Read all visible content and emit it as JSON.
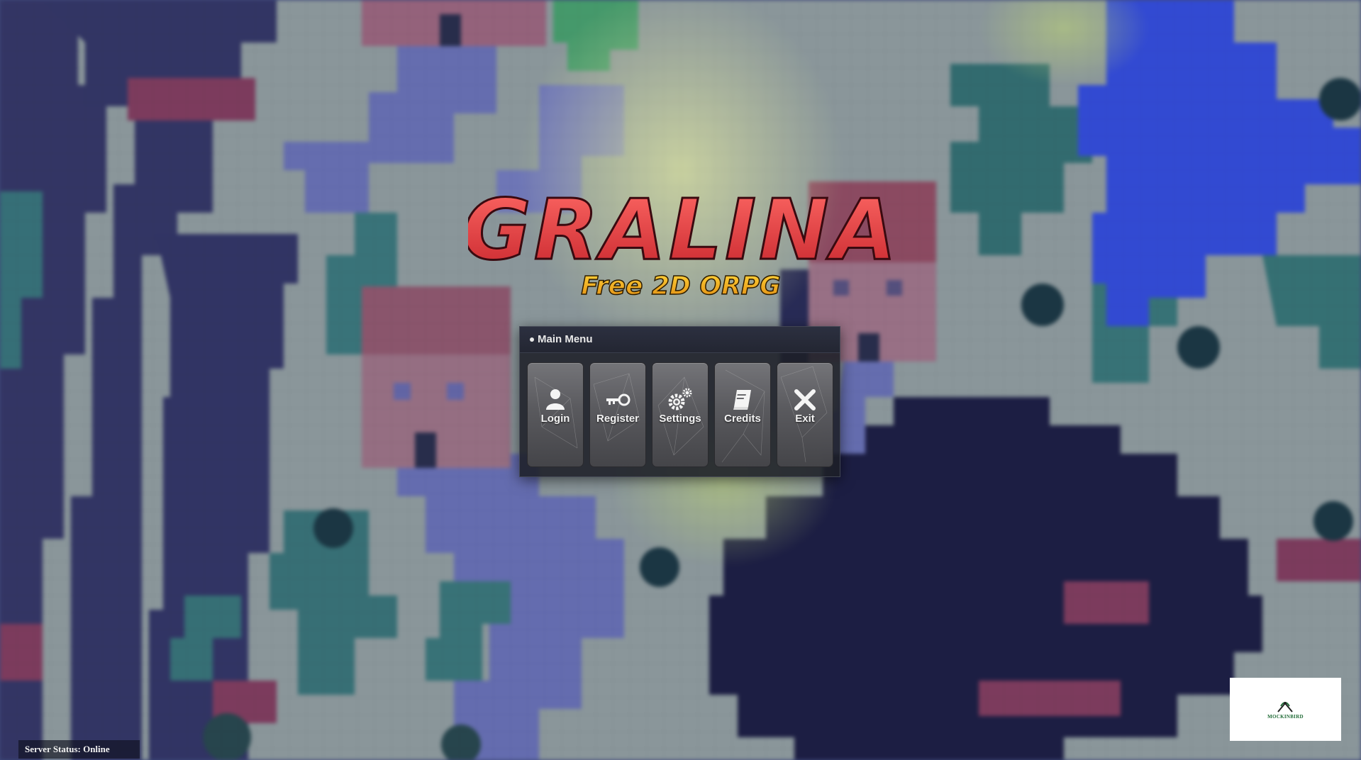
{
  "game": {
    "logo_title": "GRALINA",
    "logo_subtitle": "Free 2D ORPG"
  },
  "main_menu": {
    "title": "Main Menu",
    "buttons": [
      {
        "label": "Login",
        "icon": "user-icon"
      },
      {
        "label": "Register",
        "icon": "key-icon"
      },
      {
        "label": "Settings",
        "icon": "gears-icon"
      },
      {
        "label": "Credits",
        "icon": "book-icon"
      },
      {
        "label": "Exit",
        "icon": "close-icon"
      }
    ]
  },
  "status": {
    "server_status": "Server Status: Online"
  },
  "sponsor": {
    "text": "MOCKINBIRD"
  },
  "colors": {
    "logo_red": "#e83a3c",
    "logo_gold": "#f0b020",
    "panel_bg": "#1c1f27",
    "button_gray": "#6a6a6e"
  }
}
